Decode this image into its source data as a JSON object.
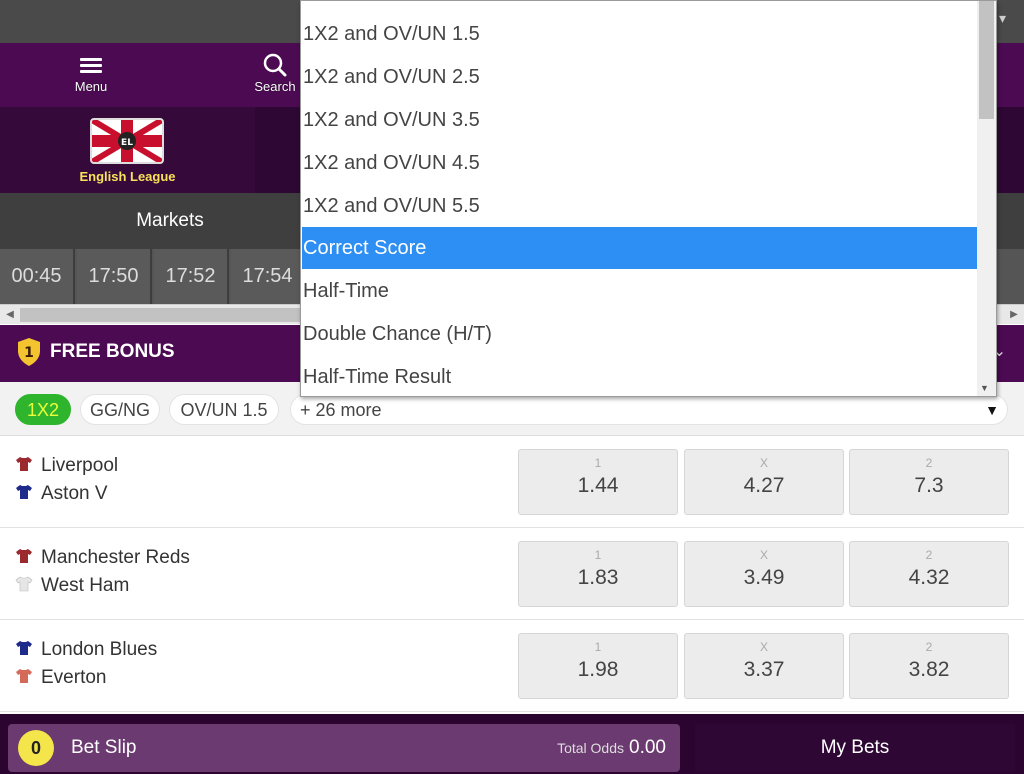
{
  "nav": {
    "menu_label": "Menu",
    "search_label": "Search"
  },
  "league": {
    "name": "English League",
    "flag_text": "EL"
  },
  "markets": {
    "label": "Markets"
  },
  "times": [
    "00:45",
    "17:50",
    "17:52",
    "17:54"
  ],
  "bonus": {
    "badge": "1",
    "label": "FREE BONUS"
  },
  "filters": {
    "pills": [
      "1X2",
      "GG/NG",
      "OV/UN 1.5"
    ],
    "more_label": "+ 26 more"
  },
  "dropdown": {
    "options": [
      "1X2 and OV/UN 1.5",
      "1X2 and OV/UN 2.5",
      "1X2 and OV/UN 3.5",
      "1X2 and OV/UN 4.5",
      "1X2 and OV/UN 5.5",
      "Correct Score",
      "Half-Time",
      "Double Chance (H/T)",
      "Half-Time Result"
    ],
    "selected": "Correct Score"
  },
  "matches": [
    {
      "home": "Liverpool",
      "away": "Aston V",
      "home_color": "#9b2a2f",
      "away_color": "#1e2b8a",
      "odds": {
        "k1": "1",
        "v1": "1.44",
        "kx": "X",
        "vx": "4.27",
        "k2": "2",
        "v2": "7.3"
      }
    },
    {
      "home": "Manchester Reds",
      "away": "West Ham",
      "home_color": "#9b2a2f",
      "away_color": "#e6e6e6",
      "odds": {
        "k1": "1",
        "v1": "1.83",
        "kx": "X",
        "vx": "3.49",
        "k2": "2",
        "v2": "4.32"
      }
    },
    {
      "home": "London Blues",
      "away": "Everton",
      "home_color": "#1e2b8a",
      "away_color": "#d46a5a",
      "odds": {
        "k1": "1",
        "v1": "1.98",
        "kx": "X",
        "vx": "3.37",
        "k2": "2",
        "v2": "3.82"
      }
    }
  ],
  "betslip": {
    "count": "0",
    "label": "Bet Slip",
    "total_odds_label": "Total Odds",
    "total_odds_value": "0.00"
  },
  "mybets": {
    "label": "My Bets"
  },
  "colors": {
    "brand_purple": "#4b0a52",
    "accent_green": "#2fb52d",
    "accent_yellow": "#f4e64a",
    "selected_blue": "#2d8ef4"
  }
}
